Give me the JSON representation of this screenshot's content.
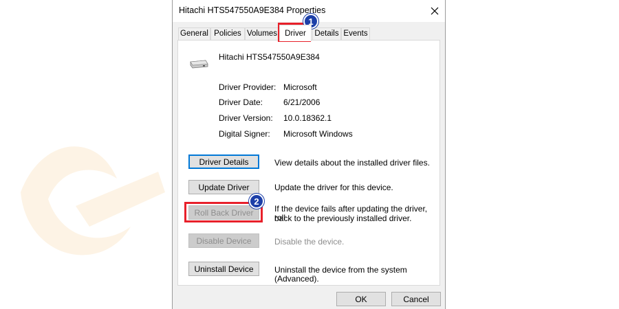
{
  "window": {
    "title": "Hitachi HTS547550A9E384 Properties"
  },
  "tabs": [
    {
      "label": "General"
    },
    {
      "label": "Policies"
    },
    {
      "label": "Volumes"
    },
    {
      "label": "Driver"
    },
    {
      "label": "Details"
    },
    {
      "label": "Events"
    }
  ],
  "device": {
    "name": "Hitachi HTS547550A9E384",
    "icon": "hard-drive-icon"
  },
  "info": [
    {
      "label": "Driver Provider:",
      "value": "Microsoft"
    },
    {
      "label": "Driver Date:",
      "value": "6/21/2006"
    },
    {
      "label": "Driver Version:",
      "value": "10.0.18362.1"
    },
    {
      "label": "Digital Signer:",
      "value": "Microsoft Windows"
    }
  ],
  "actions": [
    {
      "label": "Driver Details",
      "description": "View details about the installed driver files.",
      "enabled": true
    },
    {
      "label": "Update Driver",
      "description": "Update the driver for this device.",
      "enabled": true
    },
    {
      "label": "Roll Back Driver",
      "description_line1": "If the device fails after updating the driver, roll",
      "description_line2": "back to the previously installed driver.",
      "enabled": false
    },
    {
      "label": "Disable Device",
      "description": "Disable the device.",
      "enabled": false
    },
    {
      "label": "Uninstall Device",
      "description": "Uninstall the device from the system (Advanced).",
      "enabled": true
    }
  ],
  "footer": {
    "ok_label": "OK",
    "cancel_label": "Cancel"
  },
  "annotations": {
    "step1": "1",
    "step2": "2"
  },
  "colors": {
    "highlight": "#e8202a",
    "marker": "#1c3fa8",
    "focus": "#0078d7"
  }
}
